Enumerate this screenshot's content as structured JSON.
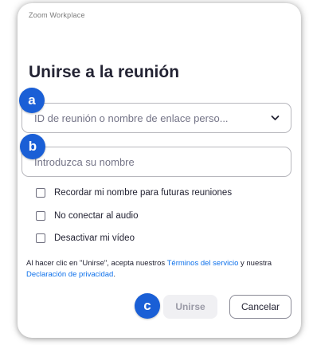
{
  "window": {
    "title": "Zoom Workplace",
    "heading": "Unirse a la reunión"
  },
  "form": {
    "meeting_id_placeholder": "ID de reunión o nombre de enlace perso...",
    "name_placeholder": "Introduzca su nombre"
  },
  "options": [
    {
      "label": "Recordar mi nombre para futuras reuniones",
      "checked": false
    },
    {
      "label": "No conectar al audio",
      "checked": false
    },
    {
      "label": "Desactivar mi vídeo",
      "checked": false
    }
  ],
  "terms": {
    "prefix": "Al hacer clic en \"Unirse\", acepta nuestros ",
    "terms_link": "Términos del servicio",
    "middle": " y nuestra ",
    "privacy_link": "Declaración de privacidad",
    "suffix": "."
  },
  "buttons": {
    "join_label": "Unirse",
    "cancel_label": "Cancelar"
  },
  "annotations": {
    "a": "a",
    "b": "b",
    "c": "c"
  },
  "colors": {
    "accent": "#0e71eb",
    "badge": "#1a5fd6",
    "text": "#232333"
  },
  "icons": {
    "dropdown": "chevron-down-icon"
  }
}
